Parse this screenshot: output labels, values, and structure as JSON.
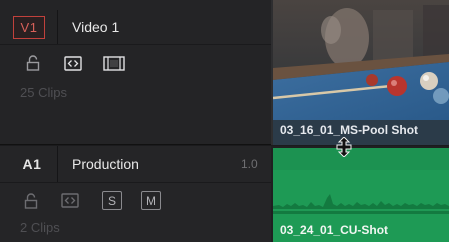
{
  "tracks": [
    {
      "id": "V1",
      "name": "Video 1",
      "clip_count": "25 Clips",
      "icons": [
        "lock-icon",
        "auto-select-icon",
        "film-strip-icon"
      ],
      "clip": {
        "name": "03_16_01_MS-Pool Shot"
      }
    },
    {
      "id": "A1",
      "name": "Production",
      "level": "1.0",
      "clip_count": "2 Clips",
      "icons": [
        "lock-icon",
        "auto-select-icon"
      ],
      "solo_label": "S",
      "mute_label": "M",
      "clip": {
        "name": "03_24_01_CU-Shot"
      }
    }
  ],
  "colors": {
    "video_track_id_border": "#c1413c",
    "audio_clip": "#1e9a55",
    "header_bg": "#242426"
  },
  "cursor": "vertical-resize-cursor-icon"
}
